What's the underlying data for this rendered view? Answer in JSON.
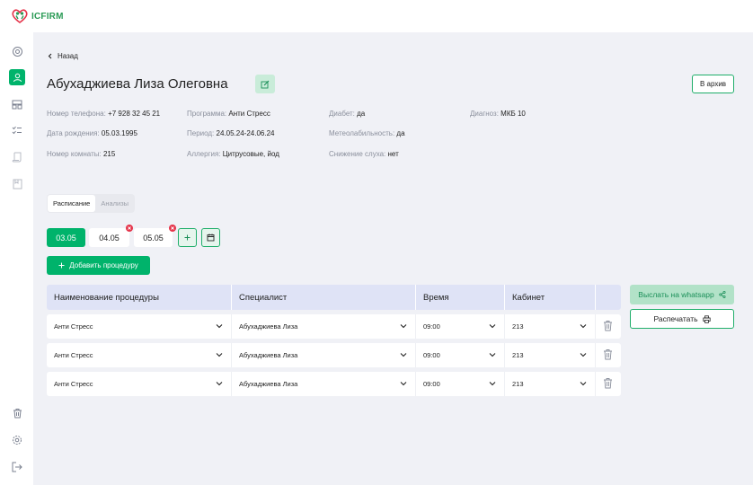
{
  "app": {
    "logo_text": "ICFIRM"
  },
  "sidebar": {
    "items": [
      {
        "icon": "target-icon"
      },
      {
        "icon": "user-icon",
        "active": true
      },
      {
        "icon": "rooms-icon"
      },
      {
        "icon": "checklist-icon"
      },
      {
        "icon": "scroll-icon"
      },
      {
        "icon": "book-icon"
      }
    ],
    "bottom": [
      {
        "icon": "trash-icon"
      },
      {
        "icon": "gear-icon"
      },
      {
        "icon": "logout-icon"
      }
    ]
  },
  "header": {
    "back_label": "Назад",
    "patient_name": "Абухаджиева Лиза Олеговна",
    "archive_label": "В архив"
  },
  "info": {
    "phone": {
      "label": "Номер телефона:",
      "value": "+7 928 32 45 21"
    },
    "birthdate": {
      "label": "Дата рождения:",
      "value": "05.03.1995"
    },
    "room": {
      "label": "Номер комнаты:",
      "value": "215"
    },
    "program": {
      "label": "Программа:",
      "value": "Анти Стресс"
    },
    "period": {
      "label": "Период:",
      "value": "24.05.24-24.06.24"
    },
    "allergy": {
      "label": "Аллергия:",
      "value": "Цитрусовые, йод"
    },
    "diabetes": {
      "label": "Диабет:",
      "value": "да"
    },
    "meteo": {
      "label": "Метеолабильность:",
      "value": "да"
    },
    "hearing": {
      "label": "Снижение слуха:",
      "value": "нет"
    },
    "diagnosis": {
      "label": "Диагноз:",
      "value": "МКБ 10"
    }
  },
  "tabs": [
    {
      "label": "Расписание",
      "active": true
    },
    {
      "label": "Анализы",
      "active": false
    }
  ],
  "dates": [
    {
      "label": "03.05",
      "active": true,
      "removable": false
    },
    {
      "label": "04.05",
      "active": false,
      "removable": true
    },
    {
      "label": "05.05",
      "active": false,
      "removable": true
    }
  ],
  "add_procedure_label": "Добавить процедуру",
  "table": {
    "headers": {
      "procedure": "Наименование процедуры",
      "specialist": "Специалист",
      "time": "Время",
      "cabinet": "Кабинет"
    },
    "rows": [
      {
        "procedure": "Анти Стресс",
        "specialist": "Абухаджиева Лиза",
        "time": "09:00",
        "cabinet": "213"
      },
      {
        "procedure": "Анти Стресс",
        "specialist": "Абухаджиева Лиза",
        "time": "09:00",
        "cabinet": "213"
      },
      {
        "procedure": "Анти Стресс",
        "specialist": "Абухаджиева Лиза",
        "time": "09:00",
        "cabinet": "213"
      }
    ]
  },
  "actions": {
    "whatsapp_label": "Выслать на whatsapp",
    "print_label": "Распечатать"
  },
  "colors": {
    "accent": "#00b36b",
    "danger": "#e5344a",
    "header_bg": "#dfe3f6"
  }
}
